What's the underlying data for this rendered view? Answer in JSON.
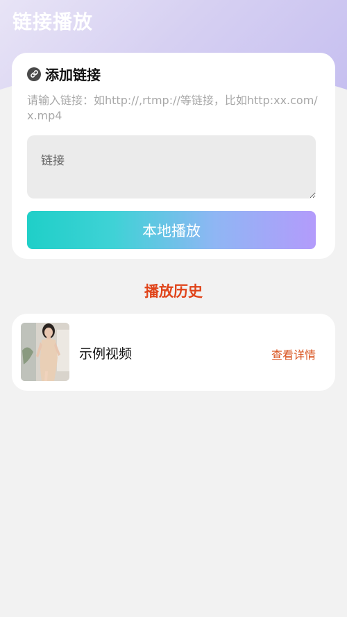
{
  "app": {
    "title": "链接播放"
  },
  "add_link": {
    "title": "添加链接",
    "hint": "请输入链接：如http://,rtmp://等链接，比如http:xx.com/x.mp4",
    "input_placeholder": "链接",
    "input_value": "",
    "play_button_label": "本地播放"
  },
  "history": {
    "section_title": "播放历史",
    "items": [
      {
        "title": "示例视频",
        "detail_label": "查看详情"
      }
    ]
  },
  "colors": {
    "accent": "#e0441a",
    "button_gradient_start": "#1fcfc8",
    "button_gradient_end": "#b39bfb",
    "background": "#f2f2f2"
  }
}
